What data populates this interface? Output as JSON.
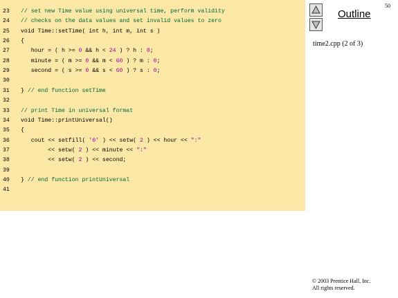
{
  "slide": {
    "page_number": "50",
    "outline_label": "Outline",
    "file_label": "time2.cpp (2 of 3)",
    "copyright_line1": "© 2003 Prentice Hall, Inc.",
    "copyright_line2": "All rights reserved.",
    "nav_icons": [
      "triangle-up-icon",
      "triangle-down-icon"
    ],
    "code_background": "#fbe8a6"
  },
  "code": {
    "lines": [
      {
        "num": "23",
        "segments": [
          {
            "t": "// set new Time value using universal time, perform validity",
            "c": "com"
          }
        ]
      },
      {
        "num": "24",
        "segments": [
          {
            "t": "// checks on the data values and set invalid values to zero",
            "c": "com"
          }
        ]
      },
      {
        "num": "25",
        "segments": [
          {
            "t": "void Time::setTime( int h, int m, int s )",
            "c": ""
          }
        ]
      },
      {
        "num": "26",
        "segments": [
          {
            "t": "{",
            "c": ""
          }
        ]
      },
      {
        "num": "27",
        "segments": [
          {
            "t": "   hour = ( h >= ",
            "c": ""
          },
          {
            "t": "0",
            "c": "str"
          },
          {
            "t": " && h < ",
            "c": ""
          },
          {
            "t": "24",
            "c": "str"
          },
          {
            "t": " ) ? h : ",
            "c": ""
          },
          {
            "t": "0",
            "c": "str"
          },
          {
            "t": ";",
            "c": ""
          }
        ]
      },
      {
        "num": "28",
        "segments": [
          {
            "t": "   minute = ( m >= ",
            "c": ""
          },
          {
            "t": "0",
            "c": "str"
          },
          {
            "t": " && m < ",
            "c": ""
          },
          {
            "t": "60",
            "c": "str"
          },
          {
            "t": " ) ? m : ",
            "c": ""
          },
          {
            "t": "0",
            "c": "str"
          },
          {
            "t": ";",
            "c": ""
          }
        ]
      },
      {
        "num": "29",
        "segments": [
          {
            "t": "   second = ( s >= ",
            "c": ""
          },
          {
            "t": "0",
            "c": "str"
          },
          {
            "t": " && s < ",
            "c": ""
          },
          {
            "t": "60",
            "c": "str"
          },
          {
            "t": " ) ? s : ",
            "c": ""
          },
          {
            "t": "0",
            "c": "str"
          },
          {
            "t": ";",
            "c": ""
          }
        ]
      },
      {
        "num": "30",
        "segments": []
      },
      {
        "num": "31",
        "segments": [
          {
            "t": "} ",
            "c": ""
          },
          {
            "t": "// end function setTime",
            "c": "com"
          }
        ]
      },
      {
        "num": "32",
        "segments": []
      },
      {
        "num": "33",
        "segments": [
          {
            "t": "// print Time in universal format",
            "c": "com"
          }
        ]
      },
      {
        "num": "34",
        "segments": [
          {
            "t": "void Time::printUniversal()",
            "c": ""
          }
        ]
      },
      {
        "num": "35",
        "segments": [
          {
            "t": "{",
            "c": ""
          }
        ]
      },
      {
        "num": "36",
        "segments": [
          {
            "t": "   cout << setfill( ",
            "c": ""
          },
          {
            "t": "'0'",
            "c": "str"
          },
          {
            "t": " ) << setw( ",
            "c": ""
          },
          {
            "t": "2",
            "c": "str"
          },
          {
            "t": " ) << hour << ",
            "c": ""
          },
          {
            "t": "\":\"",
            "c": "str"
          }
        ]
      },
      {
        "num": "37",
        "segments": [
          {
            "t": "        << setw( ",
            "c": ""
          },
          {
            "t": "2",
            "c": "str"
          },
          {
            "t": " ) << minute << ",
            "c": ""
          },
          {
            "t": "\":\"",
            "c": "str"
          }
        ]
      },
      {
        "num": "38",
        "segments": [
          {
            "t": "        << setw( ",
            "c": ""
          },
          {
            "t": "2",
            "c": "str"
          },
          {
            "t": " ) << second;",
            "c": ""
          }
        ]
      },
      {
        "num": "39",
        "segments": []
      },
      {
        "num": "40",
        "segments": [
          {
            "t": "} ",
            "c": ""
          },
          {
            "t": "// end function printUniversal",
            "c": "com"
          }
        ]
      },
      {
        "num": "41",
        "segments": []
      }
    ]
  }
}
